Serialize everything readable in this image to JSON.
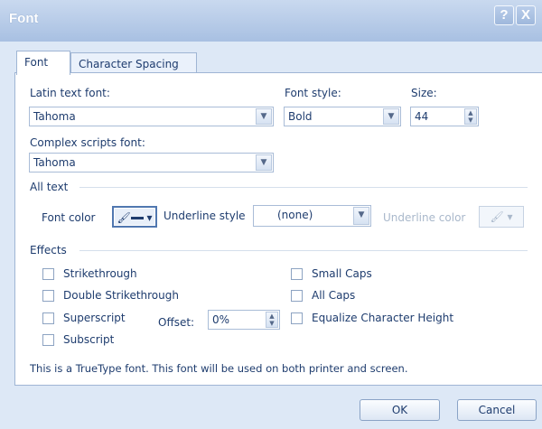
{
  "window": {
    "title": "Font",
    "help_label": "?",
    "close_label": "X"
  },
  "tabs": [
    {
      "label": "Font",
      "active": true
    },
    {
      "label": "Character Spacing",
      "active": false
    }
  ],
  "latin_font": {
    "label": "Latin text font:",
    "value": "Tahoma"
  },
  "font_style": {
    "label": "Font style:",
    "value": "Bold"
  },
  "size": {
    "label": "Size:",
    "value": "44"
  },
  "complex_font": {
    "label": "Complex scripts font:",
    "value": "Tahoma"
  },
  "all_text": {
    "heading": "All text",
    "font_color_label": "Font color",
    "underline_style_label": "Underline style",
    "underline_style_value": "(none)",
    "underline_color_label": "Underline color"
  },
  "effects": {
    "heading": "Effects",
    "strikethrough": "Strikethrough",
    "double_strikethrough": "Double Strikethrough",
    "superscript": "Superscript",
    "offset_label": "Offset:",
    "offset_value": "0%",
    "subscript": "Subscript",
    "small_caps": "Small Caps",
    "all_caps": "All Caps",
    "equalize": "Equalize Character Height"
  },
  "info_text": "This is a TrueType font. This font will be used on both printer and screen.",
  "buttons": {
    "ok": "OK",
    "cancel": "Cancel"
  },
  "icons": {
    "dropdown_arrow": "chevron-down-icon",
    "font_color": "paint-bucket-icon",
    "underline_color": "paint-bucket-icon"
  },
  "colors": {
    "title_bar": "#b9cdea",
    "panel": "#dde8f6",
    "text": "#1e3c6e",
    "disabled_text": "#a9b8cb"
  }
}
